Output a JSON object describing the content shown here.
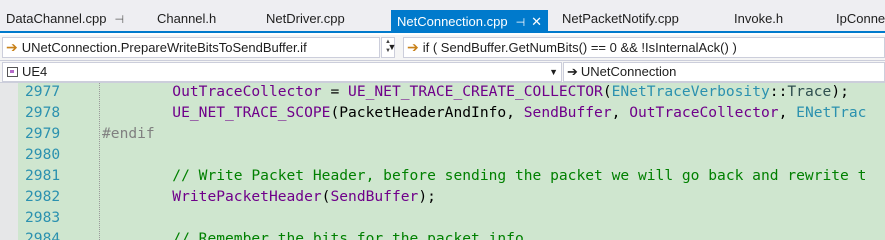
{
  "tabs": [
    {
      "label": "DataChannel.cpp",
      "pin": "⊣",
      "active": false
    },
    {
      "label": "Channel.h",
      "active": false
    },
    {
      "label": "NetDriver.cpp",
      "active": false
    },
    {
      "label": "NetConnection.cpp",
      "pin": "⊣",
      "close": "✕",
      "active": true
    },
    {
      "label": "NetPacketNotify.cpp",
      "active": false
    },
    {
      "label": "Invoke.h",
      "active": false
    },
    {
      "label": "IpConne",
      "active": false
    }
  ],
  "navbar": {
    "scope_combo": "UNetConnection.PrepareWriteBitsToSendBuffer.if",
    "member_combo": "if ( SendBuffer.GetNumBits() == 0 && !IsInternalAck() )",
    "project_combo": "UE4",
    "class_combo": "UNetConnection"
  },
  "editor": {
    "lines": [
      {
        "num": "2977",
        "indent": "        ",
        "parts": [
          {
            "t": "OutTraceCollector",
            "c": "kw-macro"
          },
          {
            "t": " = ",
            "c": ""
          },
          {
            "t": "UE_NET_TRACE_CREATE_COLLECTOR",
            "c": "kw-macro"
          },
          {
            "t": "(",
            "c": ""
          },
          {
            "t": "ENetTraceVerbosity",
            "c": "kw-type"
          },
          {
            "t": "::",
            "c": ""
          },
          {
            "t": "Trace",
            "c": "kw-enum"
          },
          {
            "t": ");",
            "c": ""
          }
        ]
      },
      {
        "num": "2978",
        "indent": "        ",
        "parts": [
          {
            "t": "UE_NET_TRACE_SCOPE",
            "c": "kw-macro"
          },
          {
            "t": "(PacketHeaderAndInfo, ",
            "c": ""
          },
          {
            "t": "SendBuffer",
            "c": "kw-macro"
          },
          {
            "t": ", ",
            "c": ""
          },
          {
            "t": "OutTraceCollector",
            "c": "kw-macro"
          },
          {
            "t": ", ",
            "c": ""
          },
          {
            "t": "ENetTrac",
            "c": "kw-type"
          }
        ]
      },
      {
        "num": "2979",
        "indent": "",
        "parts": [
          {
            "t": "#endif",
            "c": "kw-pre"
          }
        ]
      },
      {
        "num": "2980",
        "indent": "",
        "parts": []
      },
      {
        "num": "2981",
        "indent": "        ",
        "parts": [
          {
            "t": "// Write Packet Header, before sending the packet we will go back and rewrite t",
            "c": "kw-com"
          }
        ]
      },
      {
        "num": "2982",
        "indent": "        ",
        "parts": [
          {
            "t": "WritePacketHeader",
            "c": "kw-macro"
          },
          {
            "t": "(",
            "c": ""
          },
          {
            "t": "SendBuffer",
            "c": "kw-macro"
          },
          {
            "t": ");",
            "c": ""
          }
        ]
      },
      {
        "num": "2983",
        "indent": "",
        "parts": []
      },
      {
        "num": "2984",
        "indent": "        ",
        "parts": [
          {
            "t": "// Remember the bits for the packet info",
            "c": "kw-com"
          }
        ]
      }
    ]
  },
  "colors": {
    "accent": "#007acc",
    "editor_bg": "#cfe6cf",
    "line_number": "#2b91af",
    "comment": "#008000",
    "macro": "#6f008a"
  }
}
